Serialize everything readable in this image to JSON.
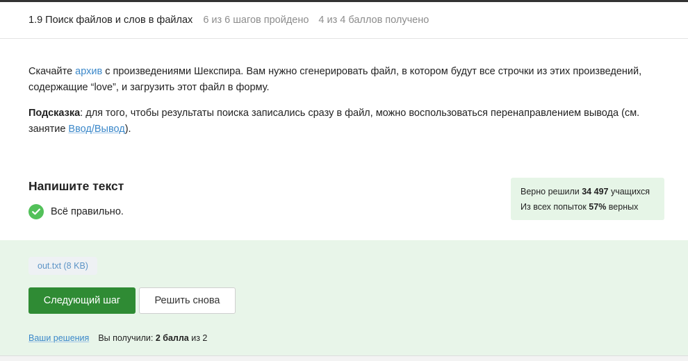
{
  "header": {
    "lesson_title": "1.9 Поиск файлов и слов в файлах",
    "steps_progress": "6 из 6 шагов пройдено",
    "points_progress": "4 из 4 баллов  получено"
  },
  "task": {
    "p1_before": "Скачайте ",
    "p1_link": "архив",
    "p1_after": " с произведениями Шекспира. Вам нужно сгенерировать файл, в котором будут все строчки из этих произведений, содержащие “love”, и загрузить этот файл в форму.",
    "hint_label": "Подсказка",
    "p2_text": ": для того, чтобы результаты поиска записались сразу в файл, можно воспользоваться перенаправлением вывода (см. занятие ",
    "p2_link": "Ввод/Вывод",
    "p2_end": ")."
  },
  "answer": {
    "title": "Напишите текст",
    "result_text": "Всё правильно.",
    "result_icon": "check-circle-icon",
    "result_color": "#53c15a"
  },
  "stats": {
    "solved_prefix": "Верно решили ",
    "solved_count": "34 497",
    "solved_suffix": " учащихся",
    "attempts_prefix": "Из всех попыток ",
    "attempts_percent": "57%",
    "attempts_suffix": " верных"
  },
  "submission": {
    "file_label": "out.txt (8 KB)",
    "next_button": "Следующий шаг",
    "retry_button": "Решить снова",
    "solutions_link": "Ваши решения",
    "score_prefix": "Вы получили: ",
    "score_value": "2 балла",
    "score_suffix": " из 2"
  },
  "colors": {
    "accent_green": "#2f8b34",
    "success_bg": "#e8f5e9",
    "link_blue": "#3a87c9"
  }
}
